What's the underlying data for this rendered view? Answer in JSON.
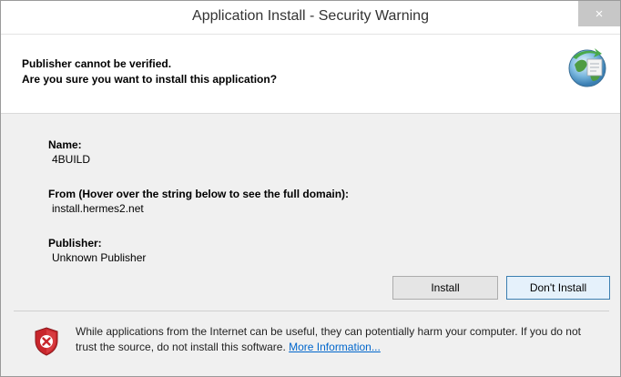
{
  "window": {
    "title": "Application Install - Security Warning",
    "close_label": "×"
  },
  "header": {
    "line1": "Publisher cannot be verified.",
    "line2": "Are you sure you want to install this application?",
    "icon": "globe-install-icon"
  },
  "details": {
    "name_label": "Name:",
    "name_value": "4BUILD",
    "from_label": "From (Hover over the string below to see the full domain):",
    "from_value": "install.hermes2.net",
    "publisher_label": "Publisher:",
    "publisher_value": "Unknown Publisher"
  },
  "buttons": {
    "install": "Install",
    "dont_install": "Don't Install"
  },
  "footer": {
    "icon": "shield-warning-icon",
    "text": "While applications from the Internet can be useful, they can potentially harm your computer. If you do not trust the source, do not install this software.",
    "link": "More Information..."
  },
  "colors": {
    "link": "#0066cc",
    "shield_red": "#c8262c",
    "default_button_border": "#3c7fb1"
  }
}
